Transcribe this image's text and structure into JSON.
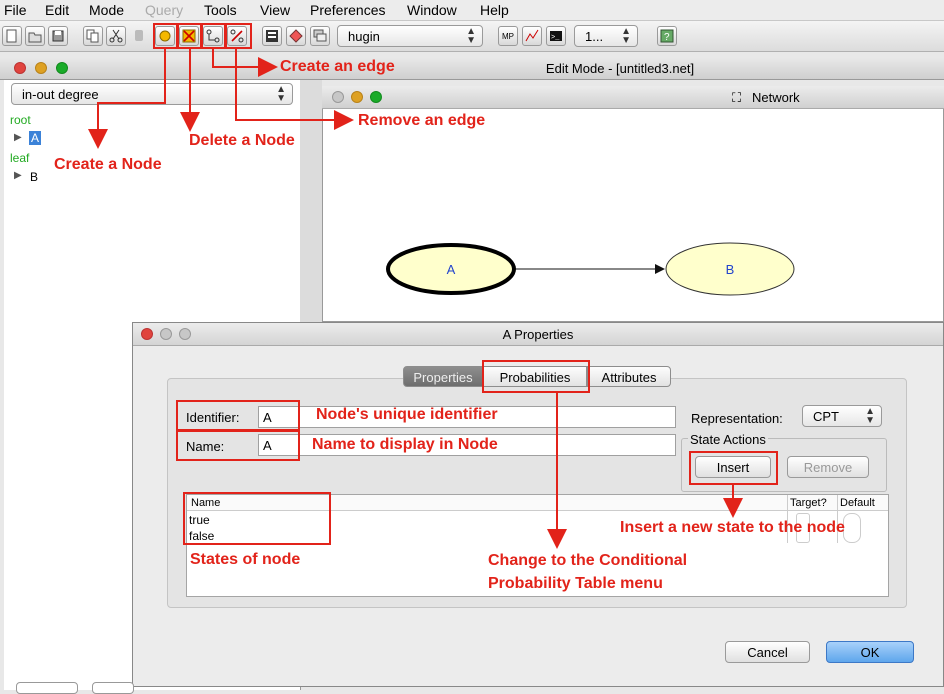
{
  "menu": [
    "File",
    "Edit",
    "Mode",
    "Query",
    "Tools",
    "View",
    "Preferences",
    "Window",
    "Help"
  ],
  "menu_disabled": "Query",
  "toolbar": {
    "engine_select": "hugin",
    "misc_select": "1..."
  },
  "main_window": {
    "title": "Edit Mode - [untitled3.net]"
  },
  "left_panel": {
    "sort_select": "in-out degree",
    "tree": [
      {
        "group": "root",
        "node": "A"
      },
      {
        "group": "leaf",
        "node": "B"
      }
    ]
  },
  "network": {
    "title": "Network",
    "nodes": [
      {
        "label": "A",
        "selected": true
      },
      {
        "label": "B",
        "selected": false
      }
    ]
  },
  "dialog": {
    "title": "A Properties",
    "tabs": [
      "Properties",
      "Probabilities",
      "Attributes"
    ],
    "active_tab": "Properties",
    "identifier_label": "Identifier:",
    "identifier_value": "A",
    "name_label": "Name:",
    "name_value": "A",
    "representation_label": "Representation:",
    "representation_value": "CPT",
    "state_actions_label": "State Actions",
    "insert_button": "Insert",
    "remove_button": "Remove",
    "states_table": {
      "columns": [
        "Name",
        "Target?",
        "Default"
      ],
      "rows": [
        "true",
        "false"
      ]
    },
    "cancel_button": "Cancel",
    "ok_button": "OK"
  },
  "annotations": {
    "create_edge": "Create an edge",
    "remove_edge": "Remove an edge",
    "create_node": "Create a Node",
    "delete_node": "Delete a Node",
    "unique_identifier": "Node's unique identifier",
    "display_name": "Name to display in Node",
    "insert_state": "Insert a new state to the node",
    "states_of_node": "States of node",
    "cpt_line1": "Change to the Conditional",
    "cpt_line2": "Probability Table menu"
  },
  "colors": {
    "annotation": "#e2231a",
    "node_fill": "#ffffcc",
    "root_leaf_label": "#22aa22",
    "ok_button": "#5ea6ec"
  }
}
